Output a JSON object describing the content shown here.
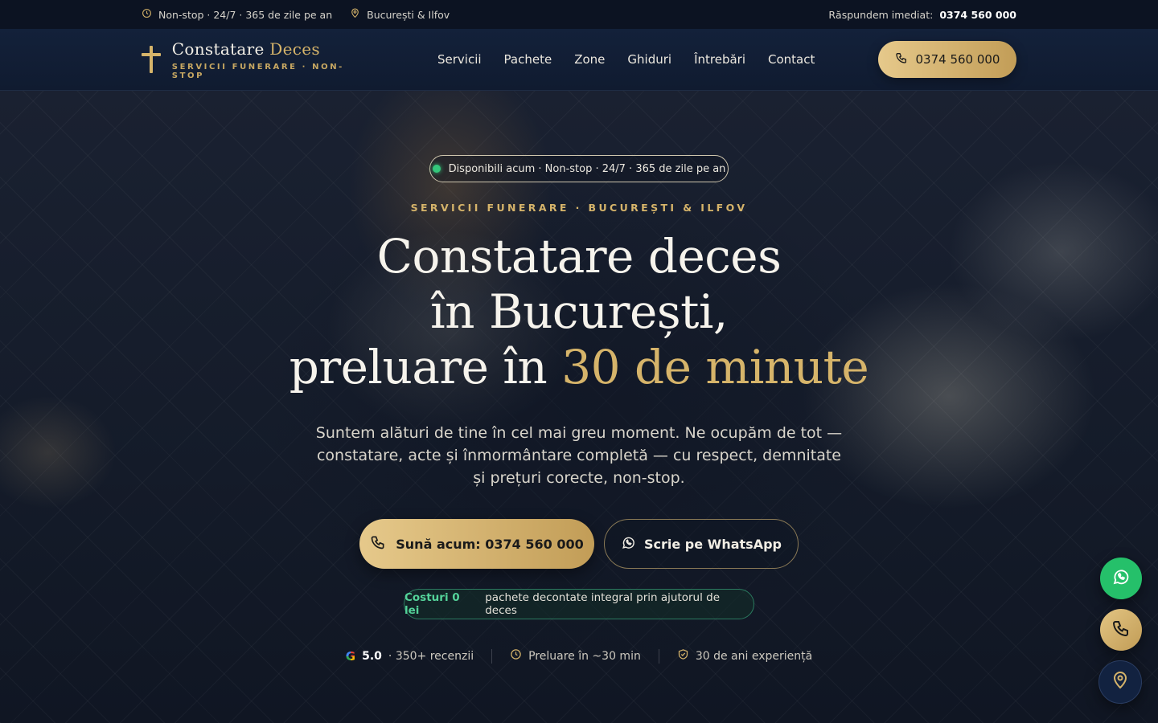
{
  "topbar": {
    "hours": "Non-stop · 24/7 · 365 de zile pe an",
    "location": "București & Ilfov",
    "respond_label": "Răspundem imediat:",
    "respond_phone": "0374 560 000"
  },
  "header": {
    "logo_name_1": "Constatare",
    "logo_name_2": "Deces",
    "logo_sub": "SERVICII FUNERARE · NON-STOP",
    "nav": [
      "Servicii",
      "Pachete",
      "Zone",
      "Ghiduri",
      "Întrebări",
      "Contact"
    ],
    "phone_button": "0374 560 000"
  },
  "hero": {
    "badge": "Disponibili acum · Non-stop · 24/7 · 365 de zile pe an",
    "eyebrow": "SERVICII FUNERARE · BUCUREȘTI & ILFOV",
    "title_line1": "Constatare deces",
    "title_line2": "în București,",
    "title_line3_a": "preluare în",
    "title_line3_b": "30 de minute",
    "lead": "Suntem alături de tine în cel mai greu moment. Ne ocupăm de tot — constatare, acte și înmormântare completă — cu respect, demnitate și prețuri corecte, non-stop.",
    "cta_call": "Sună acum: 0374 560 000",
    "cta_whatsapp": "Scrie pe WhatsApp",
    "costs_strong": "Costuri 0 lei",
    "costs_text": "pachete decontate integral prin ajutorul de deces",
    "trust": {
      "rating": "5.0",
      "reviews": "· 350+ recenzii",
      "pickup": "Preluare în ~30 min",
      "experience": "30 de ani experiență"
    }
  },
  "icons": {
    "clock": "clock-icon",
    "pin": "map-pin-icon",
    "phone": "phone-icon",
    "whatsapp": "whatsapp-icon",
    "shield": "shield-check-icon",
    "google": "google-icon"
  },
  "colors": {
    "gold": "#d6b46a",
    "navy": "#101b30",
    "green": "#25c06a"
  }
}
